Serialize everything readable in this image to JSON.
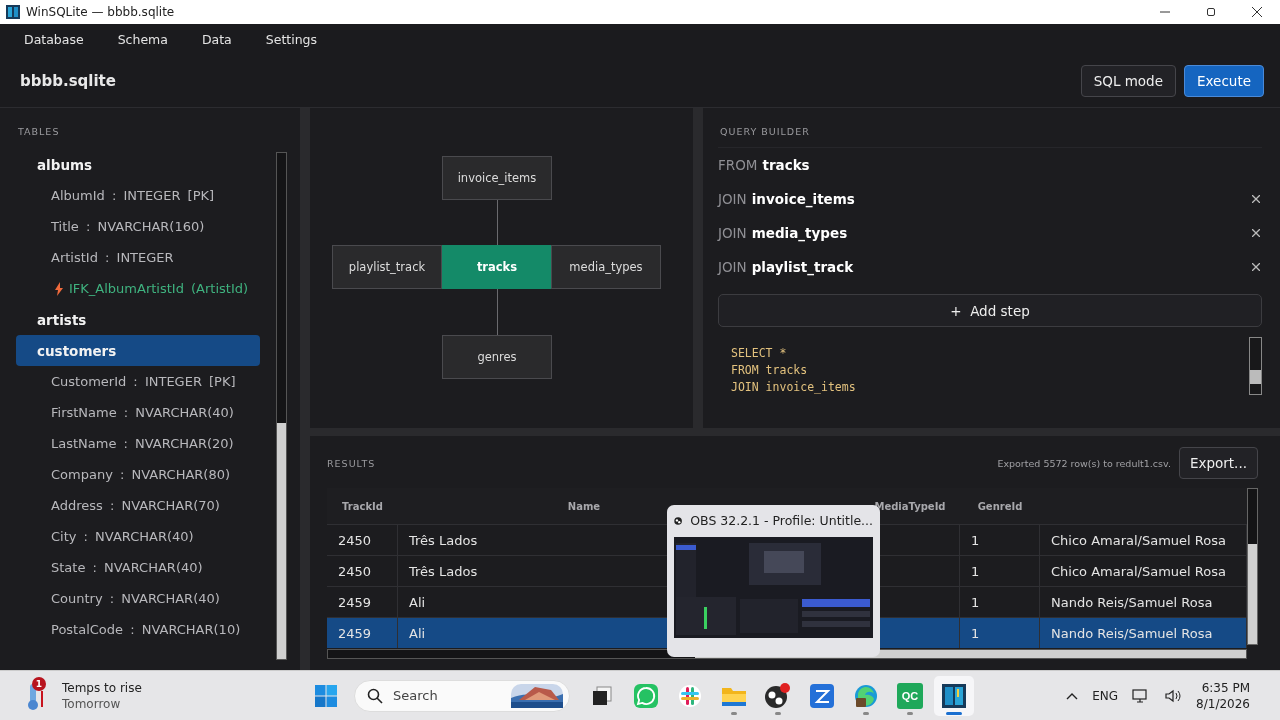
{
  "window": {
    "title": "WinSQLite — bbbb.sqlite"
  },
  "menu": [
    "Database",
    "Schema",
    "Data",
    "Settings"
  ],
  "header": {
    "file": "bbbb.sqlite",
    "buttons": [
      {
        "label": "SQL mode",
        "kind": "secondary"
      },
      {
        "label": "Execute",
        "kind": "primary"
      }
    ]
  },
  "sidebar": {
    "heading": "TABLES",
    "tables": [
      {
        "name": "albums",
        "selected": false,
        "children": [
          {
            "kind": "column",
            "text": "AlbumId : INTEGER [PK]"
          },
          {
            "kind": "column",
            "text": "Title : NVARCHAR(160)"
          },
          {
            "kind": "column",
            "text": "ArtistId : INTEGER"
          },
          {
            "kind": "foreign_key",
            "text": "IFK_AlbumArtistId (ArtistId)"
          }
        ]
      },
      {
        "name": "artists",
        "selected": false
      },
      {
        "name": "customers",
        "selected": true,
        "children": [
          {
            "kind": "column",
            "text": "CustomerId : INTEGER [PK]"
          },
          {
            "kind": "column",
            "text": "FirstName : NVARCHAR(40)"
          },
          {
            "kind": "column",
            "text": "LastName : NVARCHAR(20)"
          },
          {
            "kind": "column",
            "text": "Company : NVARCHAR(80)"
          },
          {
            "kind": "column",
            "text": "Address : NVARCHAR(70)"
          },
          {
            "kind": "column",
            "text": "City : NVARCHAR(40)"
          },
          {
            "kind": "column",
            "text": "State : NVARCHAR(40)"
          },
          {
            "kind": "column",
            "text": "Country : NVARCHAR(40)"
          },
          {
            "kind": "column",
            "text": "PostalCode : NVARCHAR(10)"
          }
        ]
      }
    ]
  },
  "diagram": {
    "nodes": [
      {
        "label": "invoice_items",
        "kind": "top"
      },
      {
        "label": "playlist_track",
        "kind": "left"
      },
      {
        "label": "tracks",
        "kind": "center"
      },
      {
        "label": "media_types",
        "kind": "right"
      },
      {
        "label": "genres",
        "kind": "bottom"
      }
    ]
  },
  "query_builder": {
    "heading": "QUERY BUILDER",
    "steps": [
      {
        "keyword": "FROM",
        "table": "tracks",
        "removable": false
      },
      {
        "keyword": "JOIN",
        "table": "invoice_items",
        "removable": true
      },
      {
        "keyword": "JOIN",
        "table": "media_types",
        "removable": true
      },
      {
        "keyword": "JOIN",
        "table": "playlist_track",
        "removable": true
      }
    ],
    "add_step": {
      "icon": "+",
      "label": "Add step"
    },
    "sql": [
      "SELECT *",
      "FROM tracks",
      "JOIN invoice_items"
    ]
  },
  "results": {
    "heading": "RESULTS",
    "status": "Exported 5572 row(s) to redult1.csv.",
    "export": "Export...",
    "columns": [
      "TrackId",
      "Name",
      null,
      "MediaTypeId",
      "GenreId",
      null
    ],
    "rows": [
      {
        "cells": [
          "2450",
          "Três Lados",
          null,
          null,
          "1",
          "Chico Amaral/Samuel Rosa"
        ],
        "selected": false
      },
      {
        "cells": [
          "2450",
          "Três Lados",
          null,
          null,
          "1",
          "Chico Amaral/Samuel Rosa"
        ],
        "selected": false
      },
      {
        "cells": [
          "2459",
          "Ali",
          null,
          null,
          "1",
          "Nando Reis/Samuel Rosa"
        ],
        "selected": false
      },
      {
        "cells": [
          "2459",
          "Ali",
          null,
          null,
          "1",
          "Nando Reis/Samuel Rosa"
        ],
        "selected": true
      }
    ]
  },
  "preview": {
    "title": "OBS 32.2.1 - Profile: Untitle..."
  },
  "taskbar": {
    "weather": {
      "line1": "Temps to rise",
      "line2": "Tomorrow",
      "badge": "1"
    },
    "search": {
      "placeholder": "Search"
    },
    "apps": [
      {
        "kind": "start",
        "running": false,
        "selected": false
      },
      {
        "kind": "search"
      },
      {
        "kind": "task-view",
        "running": false,
        "selected": false
      },
      {
        "kind": "chat",
        "running": false,
        "selected": false
      },
      {
        "kind": "hub",
        "running": false,
        "selected": false
      },
      {
        "kind": "folder",
        "running": true,
        "selected": false
      },
      {
        "kind": "recorder",
        "running": true,
        "selected": false
      },
      {
        "kind": "editor",
        "running": false,
        "selected": false
      },
      {
        "kind": "browser",
        "running": true,
        "selected": false
      },
      {
        "kind": "qc",
        "label": "QC",
        "running": true,
        "selected": false
      },
      {
        "kind": "database",
        "running": true,
        "selected": true
      }
    ],
    "tray": {
      "language": "ENG",
      "time": "6:35 PM",
      "date": "8/1/2026"
    }
  }
}
